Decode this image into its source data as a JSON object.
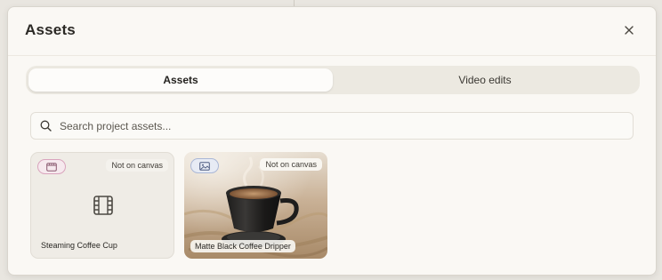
{
  "modal": {
    "title": "Assets",
    "close_icon": "close-icon"
  },
  "tabs": [
    {
      "label": "Assets",
      "active": true
    },
    {
      "label": "Video edits",
      "active": false
    }
  ],
  "search": {
    "placeholder": "Search project assets...",
    "value": "",
    "icon": "search-icon"
  },
  "assets": [
    {
      "name": "Steaming Coffee Cup",
      "status": "Not on canvas",
      "type": "video",
      "type_icon": "video-type-icon",
      "preview_icon": "film-icon"
    },
    {
      "name": "Matte Black Coffee Dripper",
      "status": "Not on canvas",
      "type": "image",
      "type_icon": "image-type-icon",
      "preview": "coffee-dripper-photo"
    }
  ],
  "colors": {
    "modal_bg": "#faf8f4",
    "page_bg": "#e9e6e0",
    "tab_track": "#ece9e1",
    "video_badge": "#d9a4bd",
    "image_badge": "#aab7d6"
  }
}
